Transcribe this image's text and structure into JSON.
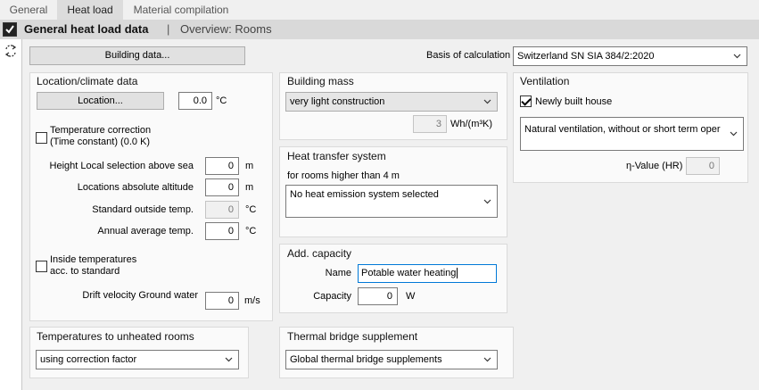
{
  "tabs": [
    {
      "label": "General"
    },
    {
      "label": "Heat load"
    },
    {
      "label": "Material compilation"
    }
  ],
  "header": {
    "title": "General heat load data",
    "separator": "|",
    "subtitle": "Overview: Rooms",
    "checked": true
  },
  "top": {
    "building_data_button": "Building data...",
    "basis_label": "Basis of calculation",
    "basis_value": "Switzerland SN SIA 384/2:2020"
  },
  "location": {
    "title": "Location/climate data",
    "location_button": "Location...",
    "temp_value": "0.0",
    "temp_unit": "°C",
    "temp_correction_line1": "Temperature correction",
    "temp_correction_line2": "(Time constant) (0.0 K)",
    "rows": [
      {
        "label": "Height Local selection above sea",
        "value": "0",
        "unit": "m"
      },
      {
        "label": "Locations absolute altitude",
        "value": "0",
        "unit": "m"
      },
      {
        "label": "Standard outside temp.",
        "value": "0",
        "unit": "°C"
      },
      {
        "label": "Annual average temp.",
        "value": "0",
        "unit": "°C"
      }
    ],
    "inside_temp_line1": "Inside temperatures",
    "inside_temp_line2": "acc. to standard",
    "drift_label": "Drift velocity Ground water",
    "drift_value": "0",
    "drift_unit": "m/s"
  },
  "unheated": {
    "title": "Temperatures to unheated rooms",
    "value": "using correction factor"
  },
  "mass": {
    "title": "Building mass",
    "value": "very light construction",
    "number": "3",
    "unit": "Wh/(m³K)"
  },
  "heat_transfer": {
    "title": "Heat transfer system",
    "sublabel": "for rooms higher than 4 m",
    "value": "No heat emission system selected"
  },
  "capacity": {
    "title": "Add. capacity",
    "name_label": "Name",
    "name_value": "Potable water heating",
    "capacity_label": "Capacity",
    "capacity_value": "0",
    "capacity_unit": "W"
  },
  "thermal_bridge": {
    "title": "Thermal bridge supplement",
    "value": "Global thermal bridge supplements"
  },
  "ventilation": {
    "title": "Ventilation",
    "new_house_label": "Newly built house",
    "new_house_checked": true,
    "value": "Natural ventilation, without or short term oper",
    "eta_label": "η-Value (HR)",
    "eta_value": "0"
  },
  "icons": {
    "header_check": "checkbox-checked-icon",
    "sync": "sync-icon",
    "dropdown": "chevron-down-icon"
  }
}
